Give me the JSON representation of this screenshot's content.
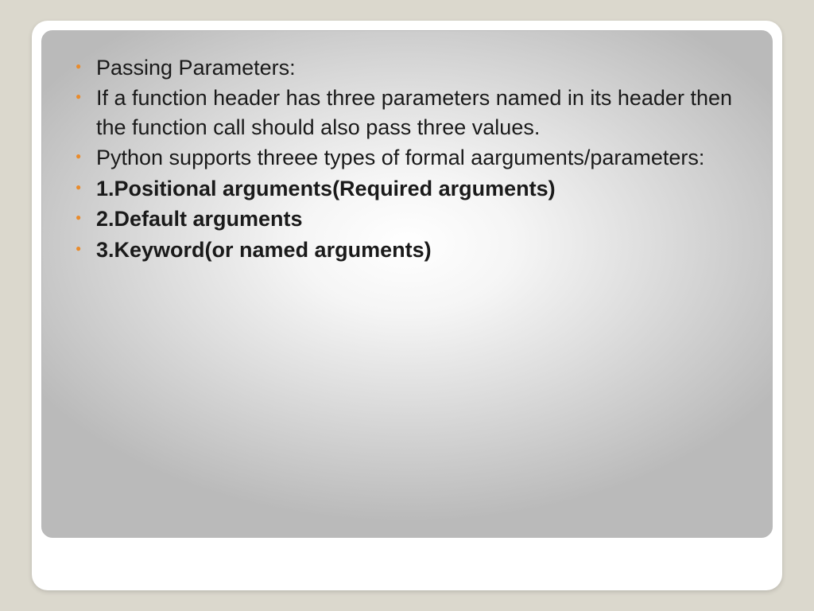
{
  "slide": {
    "bullets": [
      {
        "text": "Passing Parameters:",
        "bold": false
      },
      {
        "text": "If a function header has three parameters named in its header then the function call should also pass three values.",
        "bold": false
      },
      {
        "text": "Python supports threee types of formal aarguments/parameters:",
        "bold": false
      },
      {
        "text": "1.Positional arguments(Required arguments)",
        "bold": true
      },
      {
        "text": "2.Default arguments",
        "bold": true
      },
      {
        "text": "3.Keyword(or named arguments)",
        "bold": true
      }
    ]
  }
}
